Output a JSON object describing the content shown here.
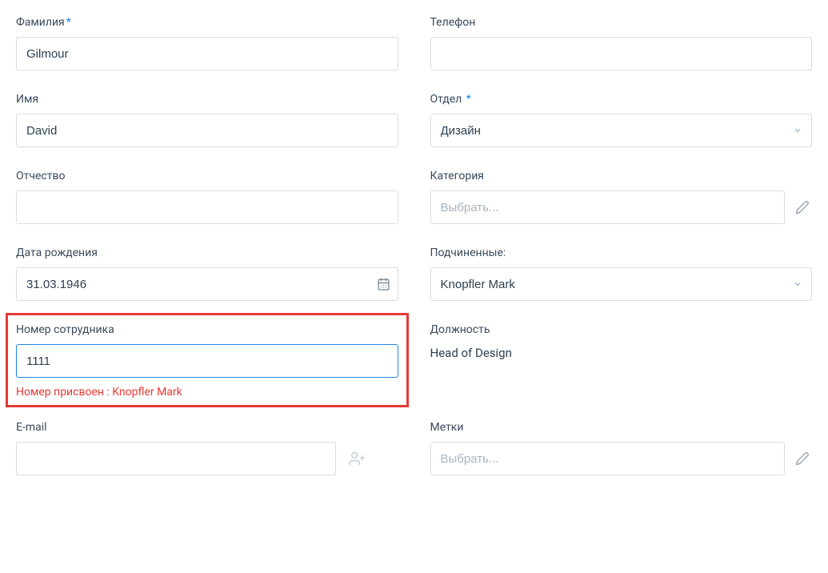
{
  "left": {
    "surname": {
      "label": "Фамилия",
      "value": "Gilmour"
    },
    "firstname": {
      "label": "Имя",
      "value": "David"
    },
    "patronymic": {
      "label": "Отчество",
      "value": ""
    },
    "birthdate": {
      "label": "Дата рождения",
      "value": "31.03.1946"
    },
    "employee_number": {
      "label": "Номер сотрудника",
      "value": "1111",
      "error": "Номер присвоен : Knopfler Mark"
    },
    "email": {
      "label": "E-mail",
      "value": ""
    }
  },
  "right": {
    "phone": {
      "label": "Телефон",
      "value": ""
    },
    "department": {
      "label": "Отдел",
      "value": "Дизайн"
    },
    "category": {
      "label": "Категория",
      "placeholder": "Выбрать..."
    },
    "subordinates": {
      "label": "Подчиненные:",
      "value": "Knopfler Mark"
    },
    "position": {
      "label": "Должность",
      "value": "Head of Design"
    },
    "tags": {
      "label": "Метки",
      "placeholder": "Выбрать..."
    }
  }
}
